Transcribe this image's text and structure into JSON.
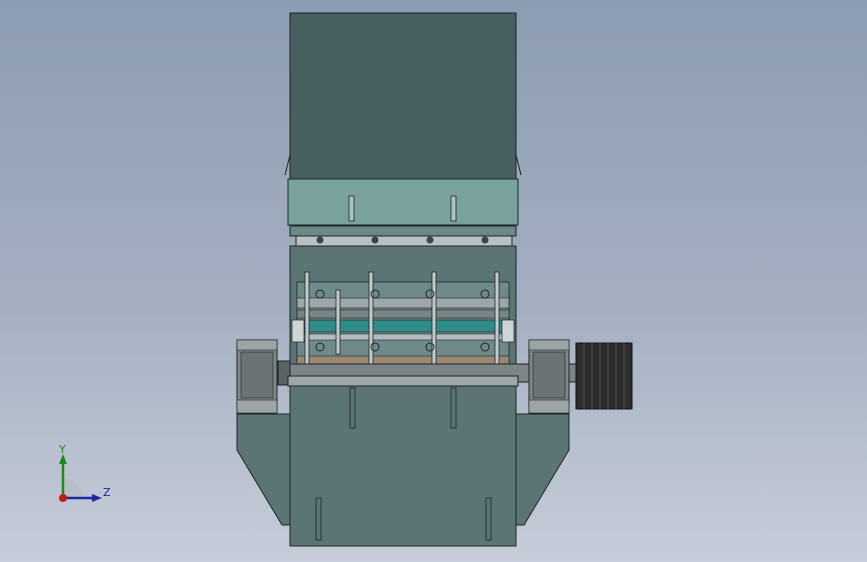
{
  "viewport": {
    "background_top": "#8c9cb2",
    "background_bottom": "#c7cdd8"
  },
  "model": {
    "body_color": "#5b7474",
    "hopper_color": "#475f60",
    "band_color": "#79a29c",
    "inner_color": "#9b8672",
    "pulley_color": "#2c2c2c",
    "bearing_color": "#7d8587"
  },
  "triad": {
    "y_label": "Y",
    "z_label": "Z",
    "y_color": "#1e8a1e",
    "z_color": "#1a2aa0",
    "x_color": "#c81818"
  }
}
